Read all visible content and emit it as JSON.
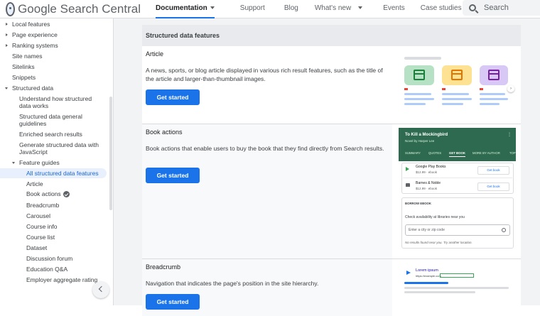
{
  "header": {
    "brand": "Google Search Central",
    "nav": [
      {
        "label": "Documentation",
        "active": true,
        "dropdown": true
      },
      {
        "label": "Support"
      },
      {
        "label": "Blog"
      },
      {
        "label": "What's new",
        "dropdown": true
      },
      {
        "label": "Events"
      },
      {
        "label": "Case studies"
      }
    ],
    "search_placeholder": "Search"
  },
  "sidebar": {
    "items": [
      {
        "label": "Local features",
        "expander": "collapsed"
      },
      {
        "label": "Page experience",
        "expander": "collapsed"
      },
      {
        "label": "Ranking systems",
        "expander": "collapsed"
      },
      {
        "label": "Site names"
      },
      {
        "label": "Sitelinks"
      },
      {
        "label": "Snippets"
      },
      {
        "label": "Structured data",
        "expander": "expanded"
      },
      {
        "label": "Understand how structured data works"
      },
      {
        "label": "Structured data general guidelines"
      },
      {
        "label": "Enriched search results"
      },
      {
        "label": "Generate structured data with JavaScript"
      },
      {
        "label": "Feature guides",
        "expander": "expanded"
      },
      {
        "label": "All structured data features",
        "active": true
      },
      {
        "label": "Article"
      },
      {
        "label": "Book actions",
        "badge": "verified"
      },
      {
        "label": "Breadcrumb"
      },
      {
        "label": "Carousel"
      },
      {
        "label": "Course info"
      },
      {
        "label": "Course list"
      },
      {
        "label": "Dataset"
      },
      {
        "label": "Discussion forum"
      },
      {
        "label": "Education Q&A"
      },
      {
        "label": "Employer aggregate rating"
      }
    ]
  },
  "table": {
    "header": "Structured data features",
    "rows": [
      {
        "title": "Article",
        "description": "A news, sports, or blog article displayed in various rich result features, such as the title of the article and larger-than-thumbnail images.",
        "button": "Get started"
      },
      {
        "title": "Book actions",
        "description": "Book actions that enable users to buy the book that they find directly from Search results.",
        "button": "Get started"
      },
      {
        "title": "Breadcrumb",
        "description": "Navigation that indicates the page's position in the site hierarchy.",
        "button": "Get started"
      }
    ]
  },
  "book_preview": {
    "title": "To Kill a Mockingbird",
    "subtitle": "Novel by Harper Lee",
    "tabs": [
      "SUMMARY",
      "QUOTES",
      "GET BOOK",
      "MORE BY AUTHOR",
      "TOP"
    ],
    "active_tab": "GET BOOK",
    "options": [
      {
        "name": "Google Play Books",
        "detail": "$12.99 · ebook",
        "action": "Get book"
      },
      {
        "name": "Barnes & Noble",
        "detail": "$12.99 · ebook",
        "action": "Get book"
      }
    ],
    "borrow_heading": "BORROW EBOOK",
    "borrow_prompt": "Check availability at libraries near you",
    "borrow_placeholder": "Enter a city or zip code",
    "borrow_note": "No results found near you. Try another location."
  },
  "breadcrumb_preview": {
    "title": "Lorem ipsum",
    "url": "https://example.com"
  },
  "colors": {
    "accent": "#1a73e8",
    "active_bg": "#e8f0fe",
    "book_green": "#2d6a4f",
    "card_green": "#b7e1c4",
    "card_yellow": "#fde293",
    "card_purple": "#d7c8f5"
  }
}
